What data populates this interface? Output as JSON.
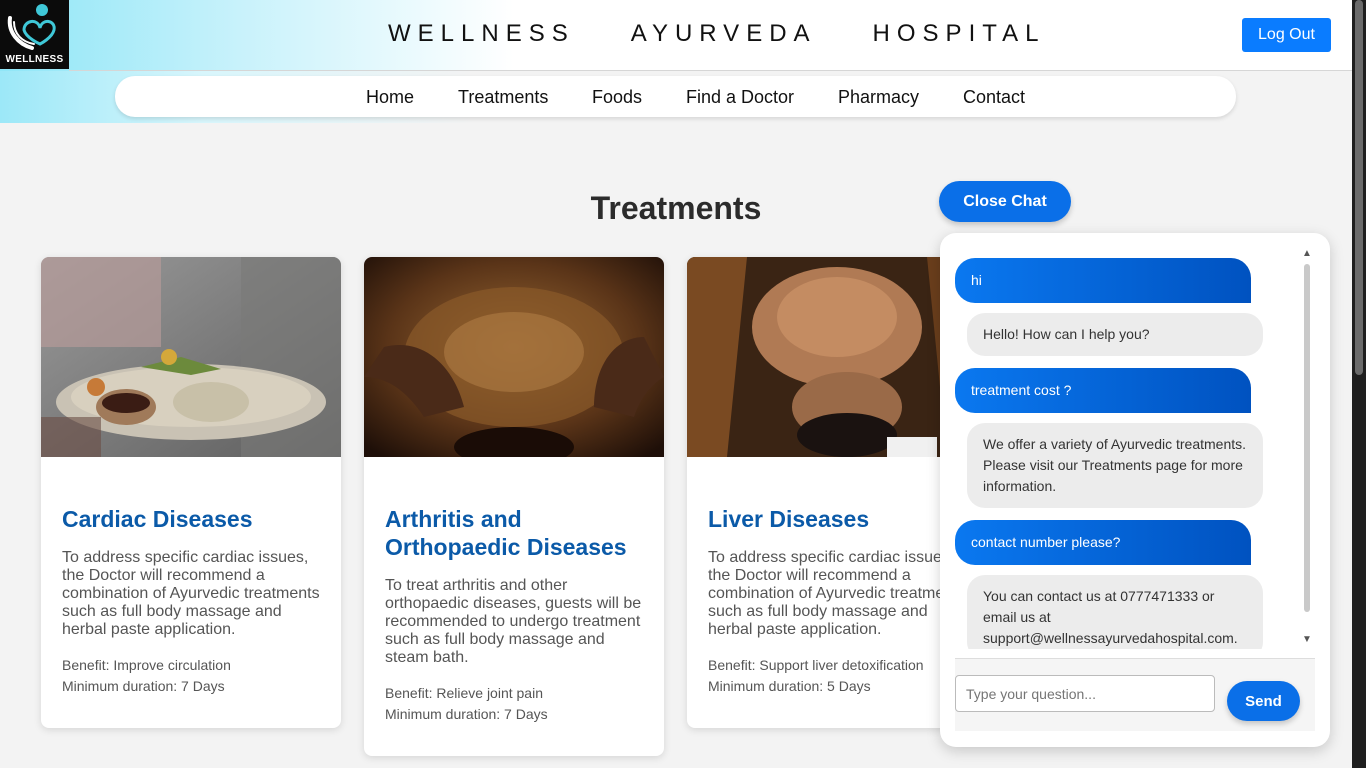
{
  "header": {
    "logo_text": "WELLNESS",
    "title_words": [
      "WELLNESS",
      "AYURVEDA",
      "HOSPITAL"
    ],
    "logout_label": "Log Out"
  },
  "nav": {
    "items": [
      "Home",
      "Treatments",
      "Foods",
      "Find a Doctor",
      "Pharmacy",
      "Contact"
    ]
  },
  "section": {
    "title": "Treatments"
  },
  "cards": [
    {
      "title": "Cardiac Diseases",
      "description": "To address specific cardiac issues, the Doctor will recommend a combination of Ayurvedic treatments such as full body massage and herbal paste application.",
      "benefit": "Benefit: Improve circulation",
      "duration": "Minimum duration: 7 Days"
    },
    {
      "title": "Arthritis and Orthopaedic Diseases",
      "description": "To treat arthritis and other orthopaedic diseases, guests will be recommended to undergo treatment such as full body massage and steam bath.",
      "benefit": "Benefit: Relieve joint pain",
      "duration": "Minimum duration: 7 Days"
    },
    {
      "title": "Liver Diseases",
      "description": "To address specific cardiac issues, the Doctor will recommend a combination of Ayurvedic treatments such as full body massage and herbal paste application.",
      "benefit": "Benefit: Support liver detoxification",
      "duration": "Minimum duration: 5 Days"
    }
  ],
  "chat": {
    "close_label": "Close Chat",
    "messages": [
      {
        "from": "user",
        "text": "hi"
      },
      {
        "from": "bot",
        "text": "Hello! How can I help you?"
      },
      {
        "from": "user",
        "text": "treatment cost ?"
      },
      {
        "from": "bot",
        "text": "We offer a variety of Ayurvedic treatments. Please visit our Treatments page for more information."
      },
      {
        "from": "user",
        "text": "contact number please?"
      },
      {
        "from": "bot",
        "text": "You can contact us at 0777471333 or email us at support@wellnessayurvedahospital.com."
      }
    ],
    "input_placeholder": "Type your question...",
    "send_label": "Send"
  },
  "colors": {
    "accent": "#0a7cff",
    "card_title": "#0b5aa8",
    "header_gradient_start": "#8fe6f7"
  }
}
